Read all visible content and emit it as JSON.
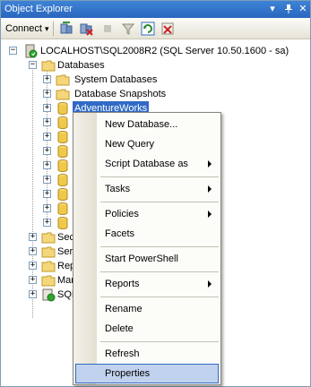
{
  "window": {
    "title": "Object Explorer",
    "pin_glyph": "▾",
    "pin2_glyph": "ᵩ",
    "close_glyph": "✕"
  },
  "toolbar": {
    "connect_label": "Connect",
    "connect_arrow": "▾"
  },
  "tree": {
    "server": "LOCALHOST\\SQL2008R2 (SQL Server 10.50.1600 - sa)",
    "databases": "Databases",
    "system_databases": "System Databases",
    "database_snapshots": "Database Snapshots",
    "adventureworks": "AdventureWorks",
    "security": "Sec",
    "server_objects": "Serv",
    "replication": "Rep",
    "management": "Mar",
    "agent": "SQL"
  },
  "context_menu": {
    "items": [
      {
        "label": "New Database...",
        "submenu": false
      },
      {
        "label": "New Query",
        "submenu": false
      },
      {
        "label": "Script Database as",
        "submenu": true
      },
      {
        "label": "Tasks",
        "submenu": true
      },
      {
        "label": "Policies",
        "submenu": true
      },
      {
        "label": "Facets",
        "submenu": false
      },
      {
        "label": "Start PowerShell",
        "submenu": false
      },
      {
        "label": "Reports",
        "submenu": true
      },
      {
        "label": "Rename",
        "submenu": false
      },
      {
        "label": "Delete",
        "submenu": false
      },
      {
        "label": "Refresh",
        "submenu": false
      },
      {
        "label": "Properties",
        "submenu": false,
        "highlighted": true
      }
    ]
  },
  "colors": {
    "selection": "#316ac5",
    "menu_highlight": "#c1d2ee",
    "titlebar": "#2a66bf"
  }
}
